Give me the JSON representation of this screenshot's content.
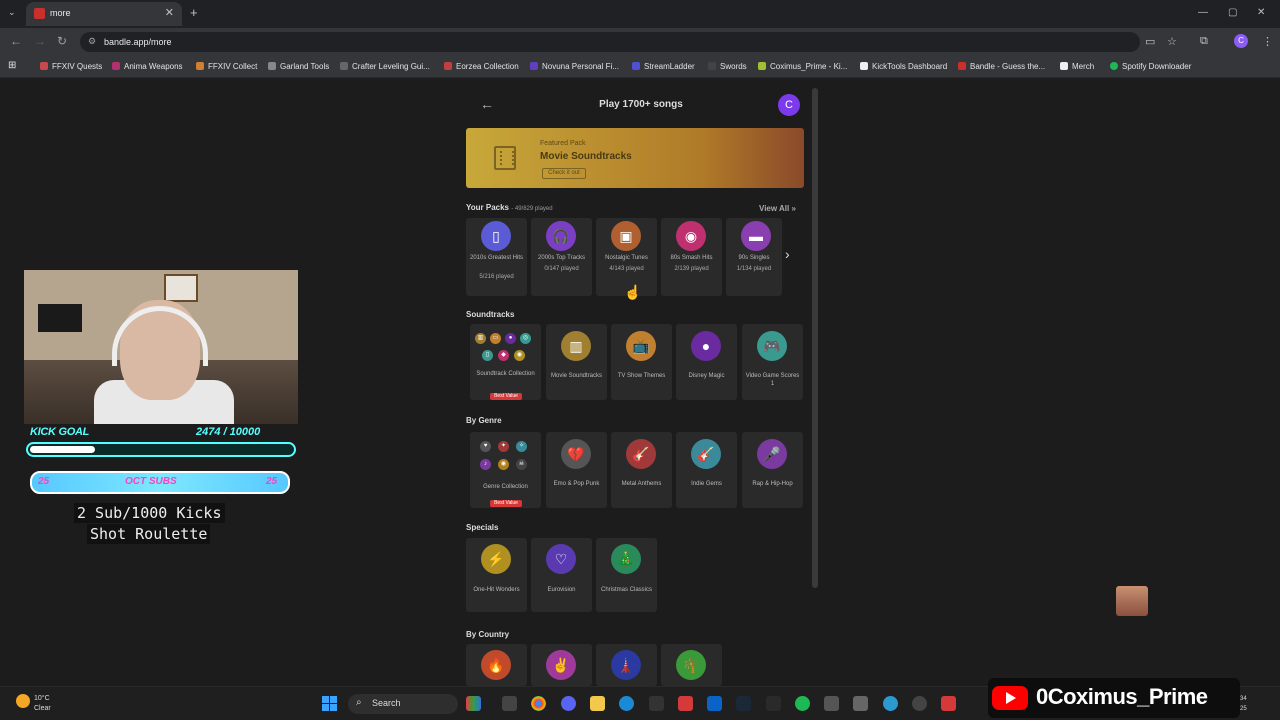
{
  "browser": {
    "tab_title": "more",
    "tab_close": "✕",
    "new_tab": "+",
    "url": "bandle.app/more",
    "window_controls": [
      "—",
      "▢",
      "✕"
    ],
    "profile_initial": "C",
    "bookmarks": [
      {
        "label": "FFXIV Quests",
        "color": "#c94a4a"
      },
      {
        "label": "Anima Weapons",
        "color": "#b03070"
      },
      {
        "label": "FFXIV Collect",
        "color": "#d08030"
      },
      {
        "label": "Garland Tools",
        "color": "#888888"
      },
      {
        "label": "Crafter Leveling Gui...",
        "color": "#666666"
      },
      {
        "label": "Eorzea Collection",
        "color": "#c04040"
      },
      {
        "label": "Novuna Personal Fi...",
        "color": "#6040c0"
      },
      {
        "label": "StreamLadder",
        "color": "#5050d0"
      },
      {
        "label": "Swords",
        "color": "#444444"
      },
      {
        "label": "Coximus_Prime - Ki...",
        "color": "#a0c030"
      },
      {
        "label": "KickTools Dashboard",
        "color": "#eeeeee"
      },
      {
        "label": "Bandle - Guess the...",
        "color": "#c9302c"
      },
      {
        "label": "Merch",
        "color": "#eeeeee"
      },
      {
        "label": "Spotify Downloader",
        "color": "#1db954"
      }
    ]
  },
  "app": {
    "header_title": "Play 1700+ songs",
    "user_initial": "C",
    "featured": {
      "label": "Featured Pack",
      "name": "Movie Soundtracks",
      "cta": "Check it out"
    },
    "your_packs": {
      "title": "Your Packs",
      "subtitle": "- 49/829 played",
      "view_all": "View All »",
      "items": [
        {
          "name": "2010s Greatest Hits",
          "played": "5/216 played",
          "color": "#5b5bd6",
          "icon": "▯"
        },
        {
          "name": "2000s Top Tracks",
          "played": "0/147 played",
          "color": "#7b3fc4",
          "icon": "🎧"
        },
        {
          "name": "Nostalgic Tunes",
          "played": "4/143 played",
          "color": "#b06030",
          "icon": "▣"
        },
        {
          "name": "80s Smash Hits",
          "played": "2/139 played",
          "color": "#c03070",
          "icon": "◉"
        },
        {
          "name": "90s Singles",
          "played": "1/134 played",
          "color": "#8a3fb0",
          "icon": "▬"
        }
      ]
    },
    "soundtracks": {
      "title": "Soundtracks",
      "items": [
        {
          "name": "Soundtrack Collection",
          "badge": "Best Value"
        },
        {
          "name": "Movie Soundtracks",
          "color": "#a08030",
          "icon": "▥"
        },
        {
          "name": "TV Show Themes",
          "color": "#c08030",
          "icon": "📺"
        },
        {
          "name": "Disney Magic",
          "color": "#6a2aa0",
          "icon": "●"
        },
        {
          "name": "Video Game Scores 1",
          "color": "#3a9a90",
          "icon": "🎮"
        }
      ]
    },
    "by_genre": {
      "title": "By Genre",
      "items": [
        {
          "name": "Genre Collection",
          "badge": "Best Value"
        },
        {
          "name": "Emo & Pop Punk",
          "color": "#555555",
          "icon": "💔"
        },
        {
          "name": "Metal Anthems",
          "color": "#a03a3a",
          "icon": "🎸"
        },
        {
          "name": "Indie Gems",
          "color": "#3a8a9a",
          "icon": "🎸"
        },
        {
          "name": "Rap & Hip-Hop",
          "color": "#7a3aa0",
          "icon": "🎤"
        }
      ]
    },
    "specials": {
      "title": "Specials",
      "items": [
        {
          "name": "One-Hit Wonders",
          "color": "#b09020",
          "icon": "⚡"
        },
        {
          "name": "Eurovision",
          "color": "#5a3ab0",
          "icon": "♡"
        },
        {
          "name": "Christmas Classics",
          "color": "#2a8a5a",
          "icon": "🎄"
        }
      ]
    },
    "by_country": {
      "title": "By Country",
      "items": [
        {
          "color": "#c04a2a",
          "icon": "🔥"
        },
        {
          "color": "#a03a9a",
          "icon": "✌"
        },
        {
          "color": "#2a3aa0",
          "icon": "🗼"
        },
        {
          "color": "#3a9a3a",
          "icon": "🌴"
        }
      ]
    }
  },
  "overlay": {
    "kick_goal_label": "KICK GOAL",
    "kick_goal_progress": "2474 / 10000",
    "kick_goal_fraction": 0.2474,
    "subs_left": "25",
    "subs_title": "OCT SUBS",
    "subs_right": "25",
    "roulette_line1": "2 Sub/1000 Kicks",
    "roulette_line2": "Shot Roulette",
    "youtube_name": "0Coximus_Prime"
  },
  "taskbar": {
    "weather_temp": "10°C",
    "weather_desc": "Clear",
    "search_label": "Search",
    "clock_top": "34",
    "clock_bottom": "25"
  }
}
